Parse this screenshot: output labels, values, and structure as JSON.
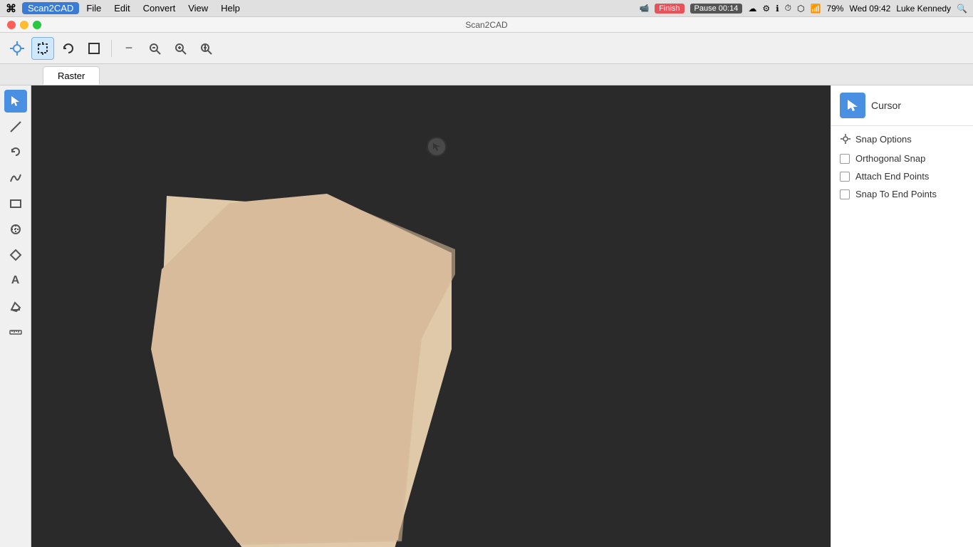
{
  "menubar": {
    "apple": "⌘",
    "app_name": "Scan2CAD",
    "items": [
      "File",
      "Edit",
      "Convert",
      "View",
      "Help"
    ],
    "title": "Scan2CAD",
    "finish_label": "Finish",
    "pause_label": "Pause 00:14",
    "time": "Wed 09:42",
    "user": "Luke Kennedy",
    "battery": "79%"
  },
  "toolbar": {
    "tools": [
      {
        "name": "home-tool",
        "icon": "⌂",
        "active": false
      },
      {
        "name": "crosshair-tool",
        "icon": "✛",
        "active": true
      },
      {
        "name": "rotate-tool",
        "icon": "↺",
        "active": false
      },
      {
        "name": "crop-tool",
        "icon": "⊡",
        "active": false
      }
    ],
    "zoom_tools": [
      {
        "name": "zoom-out-tool",
        "icon": "−",
        "active": false
      },
      {
        "name": "zoom-fit-tool",
        "icon": "⊖",
        "active": false
      },
      {
        "name": "zoom-in-tool",
        "icon": "+",
        "active": false
      },
      {
        "name": "zoom-reset-tool",
        "icon": "⊕",
        "active": false
      }
    ]
  },
  "tabs": [
    {
      "name": "raster-tab",
      "label": "Raster",
      "active": true
    }
  ],
  "left_toolbar": {
    "tools": [
      {
        "name": "select-tool",
        "icon": "↖",
        "active": true
      },
      {
        "name": "line-tool",
        "icon": "/",
        "active": false
      },
      {
        "name": "undo-tool",
        "icon": "↩",
        "active": false
      },
      {
        "name": "curve-tool",
        "icon": "⌒",
        "active": false
      },
      {
        "name": "rect-tool",
        "icon": "▭",
        "active": false
      },
      {
        "name": "circle-tool",
        "icon": "○",
        "active": false
      },
      {
        "name": "diamond-tool",
        "icon": "◇",
        "active": false
      },
      {
        "name": "text-tool",
        "icon": "A",
        "active": false
      },
      {
        "name": "eraser-tool",
        "icon": "◈",
        "active": false
      },
      {
        "name": "measure-tool",
        "icon": "📏",
        "active": false
      }
    ]
  },
  "right_panel": {
    "cursor_label": "Cursor",
    "snap_options_label": "Snap Options",
    "snap_icon": "⊹",
    "checkboxes": [
      {
        "name": "orthogonal-snap",
        "label": "Orthogonal Snap",
        "checked": false
      },
      {
        "name": "attach-end-points",
        "label": "Attach End Points",
        "checked": false
      },
      {
        "name": "snap-to-end-points",
        "label": "Snap To End Points",
        "checked": false
      }
    ],
    "cursor_icon": "↖"
  },
  "colors": {
    "accent_blue": "#4a90e2",
    "canvas_bg": "#2a2a2a",
    "beige_shape": "#dfc9a8",
    "toolbar_bg": "#f0f0f0",
    "panel_bg": "#ffffff",
    "finish_green": "#4caf50",
    "finish_red": "#ff3b30"
  }
}
